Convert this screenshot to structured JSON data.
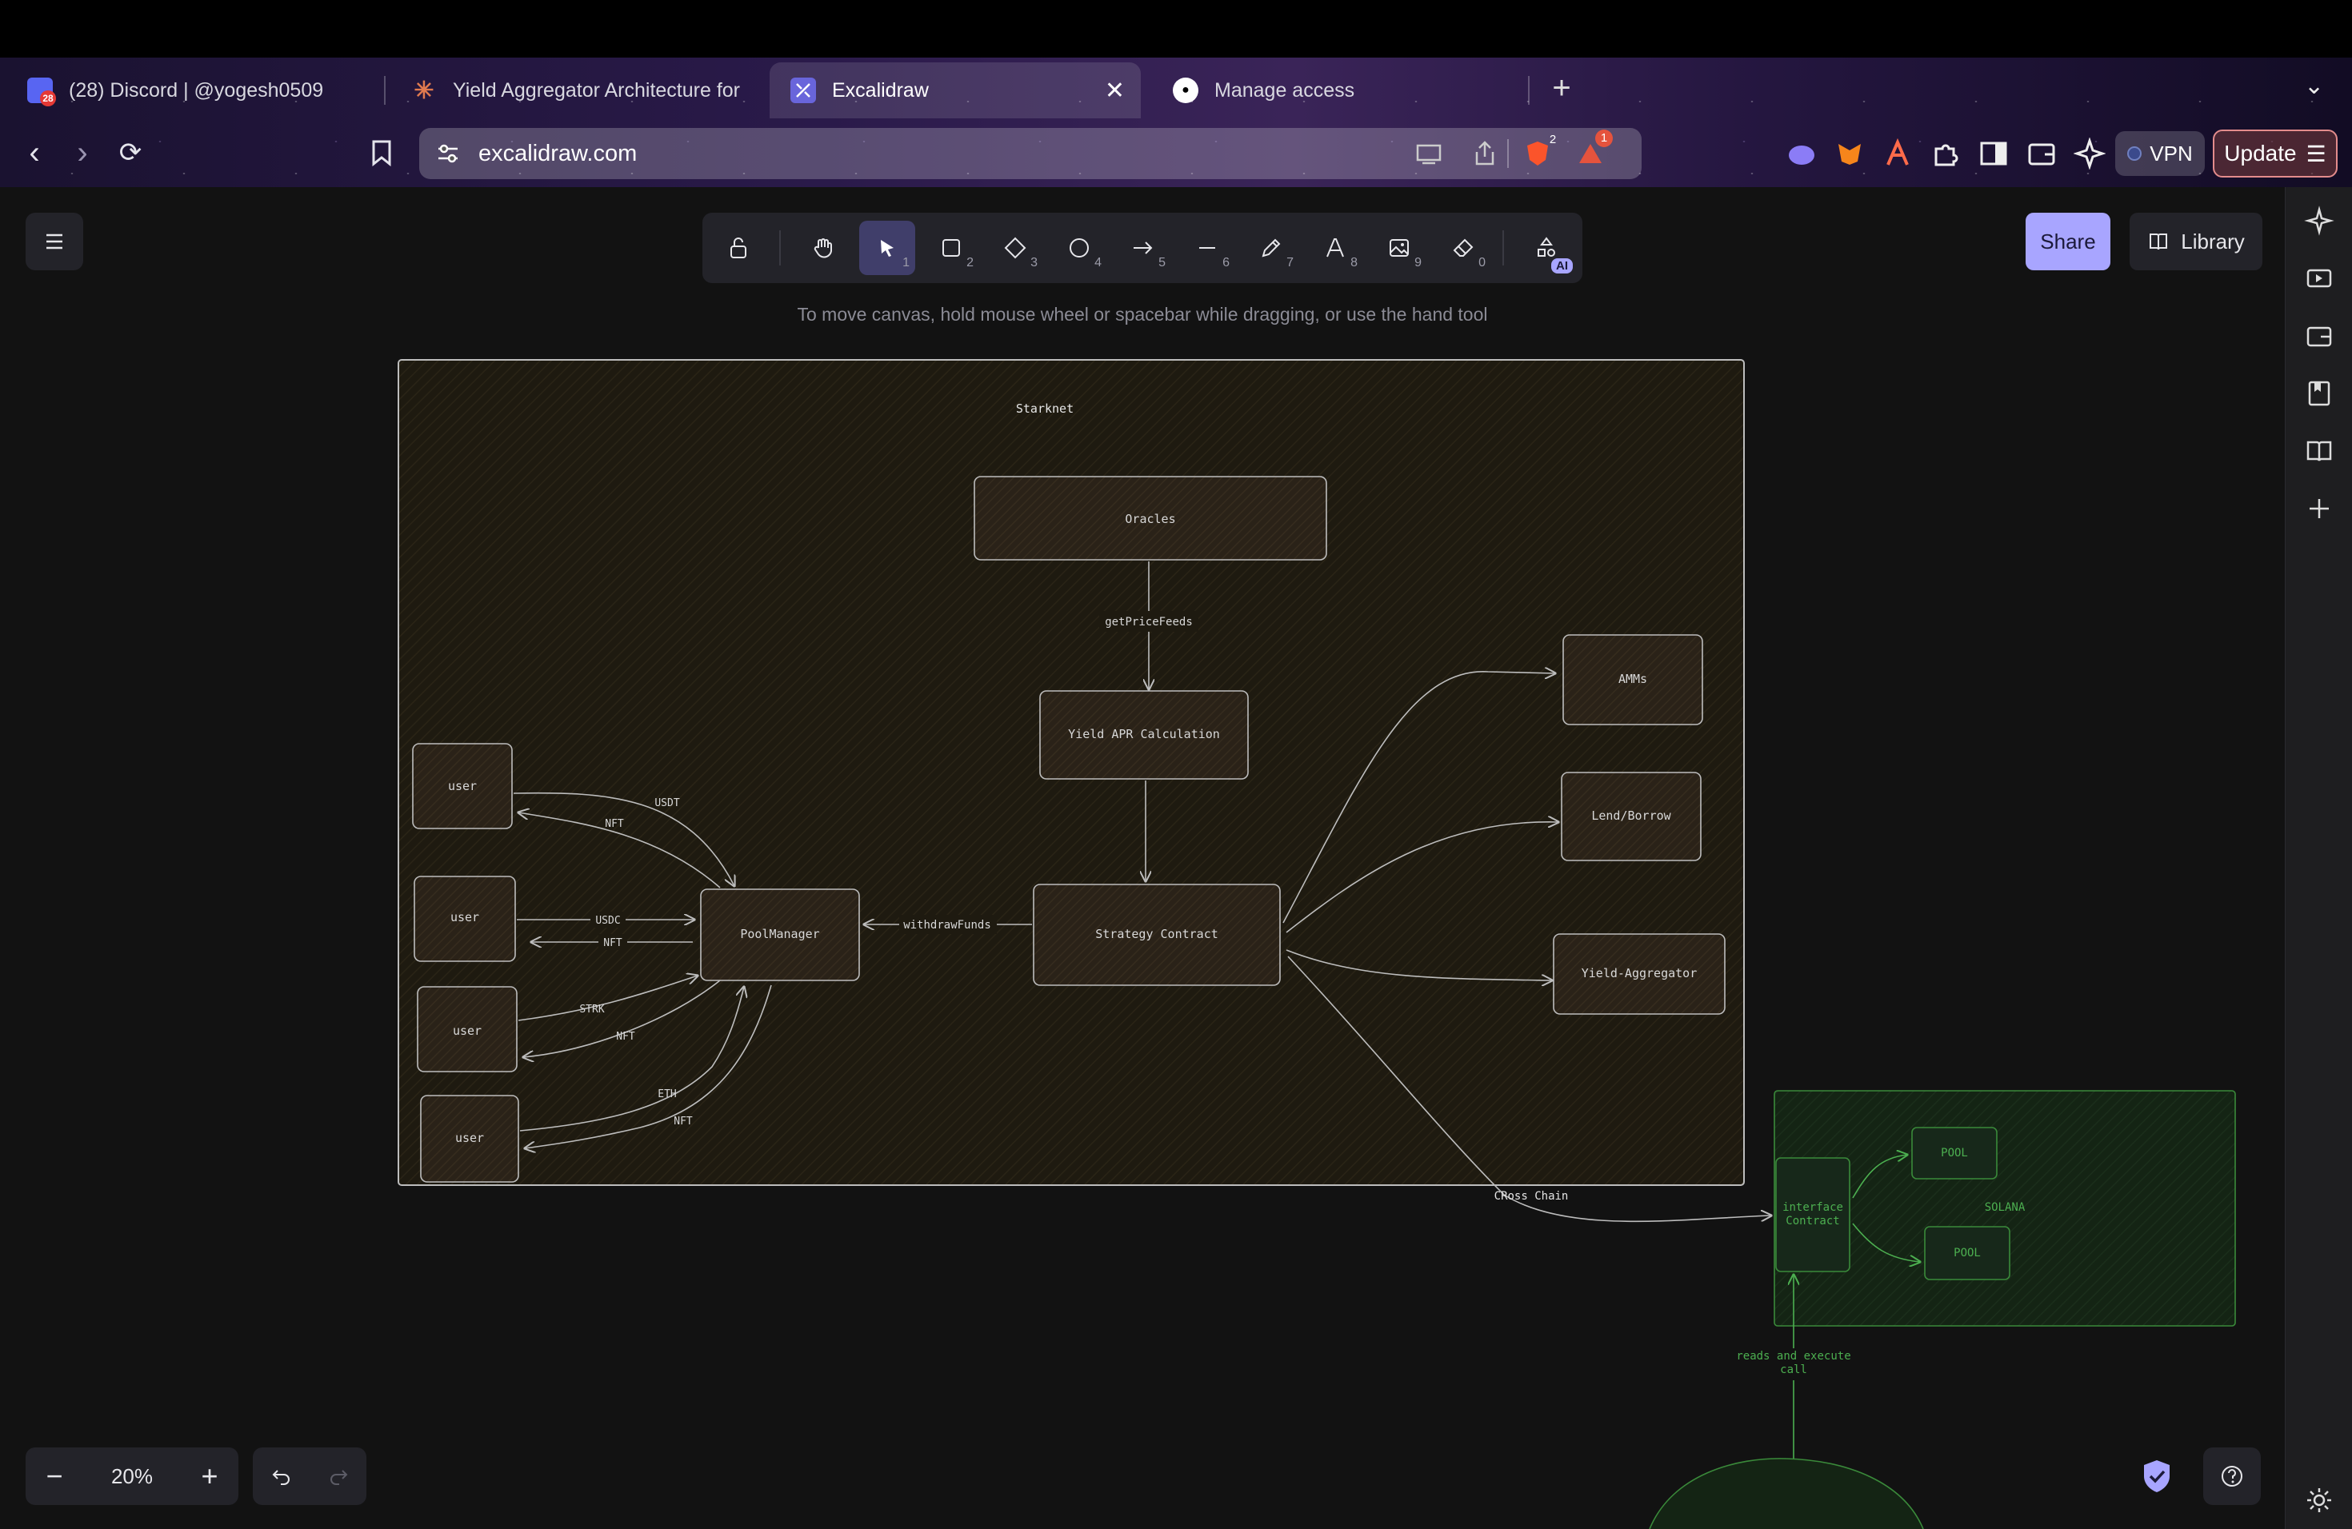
{
  "browser": {
    "tabs": [
      {
        "label": "(28) Discord | @yogesh0509",
        "badge": "28"
      },
      {
        "label": "Yield Aggregator Architecture for"
      },
      {
        "label": "Excalidraw"
      },
      {
        "label": "Manage access"
      }
    ],
    "url": "excalidraw.com",
    "brave_badge": "2",
    "alert_badge": "1",
    "vpn_label": "VPN",
    "update_label": "Update"
  },
  "app": {
    "hint": "To move canvas, hold mouse wheel or spacebar while dragging, or use the hand tool",
    "share_label": "Share",
    "library_label": "Library",
    "zoom": "20%",
    "tool_keys": [
      "1",
      "2",
      "3",
      "4",
      "5",
      "6",
      "7",
      "8",
      "9",
      "0"
    ],
    "ai_badge": "AI"
  },
  "diagram": {
    "frame_title": "Starknet",
    "nodes": {
      "oracles": "Oracles",
      "yield_calc": "Yield APR Calculation",
      "strategy": "Strategy Contract",
      "pool_manager": "PoolManager",
      "amms": "AMMs",
      "lend_borrow": "Lend/Borrow",
      "yield_agg": "Yield-Aggregator",
      "user1": "user",
      "user2": "user",
      "user3": "user",
      "user4": "user",
      "interface": [
        "interface",
        "Contract"
      ],
      "pool1": "POOL",
      "pool2": "POOL"
    },
    "labels": {
      "get_price": "getPriceFeeds",
      "withdraw": "withdrawFunds",
      "usdt": "USDT",
      "nft1": "NFT",
      "usdc": "USDC",
      "nft2": "NFT",
      "strk": "STRK",
      "nft3": "NFT",
      "eth": "ETH",
      "nft4": "NFT",
      "cross_chain": "CRoss Chain",
      "solana": "SOLANA",
      "reads": [
        "reads and execute",
        "call"
      ]
    }
  },
  "colors": {
    "accent": "#a8a5ff",
    "stroke": "#cfcfcf",
    "green": "#4caf50"
  }
}
